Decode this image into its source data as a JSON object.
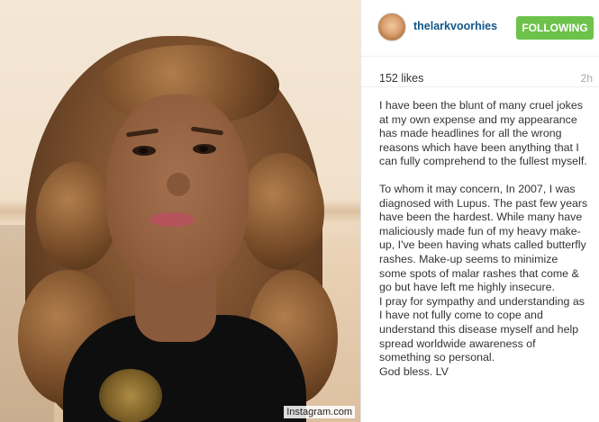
{
  "post": {
    "username": "thelarkvoorhies",
    "follow_label": "FOLLOWING",
    "likes": "152 likes",
    "time": "2h",
    "caption": {
      "p1": "I have been the blunt of many cruel jokes at my own expense and my appearance has made headlines for all the wrong reasons which have been anything that I can fully comprehend to the fullest myself.",
      "p2": "To whom it may concern, In 2007, I was diagnosed with Lupus. The past few years have been the hardest. While many have maliciously made fun of my heavy make-up, I've been having whats called butterfly rashes. Make-up seems to minimize some spots of malar rashes that come & go but have left me highly insecure.",
      "p3": "I pray for sympathy and understanding as I have not fully come to cope and understand this disease myself and help spread worldwide awareness of something so personal.",
      "p4": "God bless. LV"
    }
  },
  "watermark": "Instagram.com",
  "colors": {
    "follow_button": "#6cc24a",
    "username": "#125688",
    "timestamp": "#a5a7aa"
  }
}
